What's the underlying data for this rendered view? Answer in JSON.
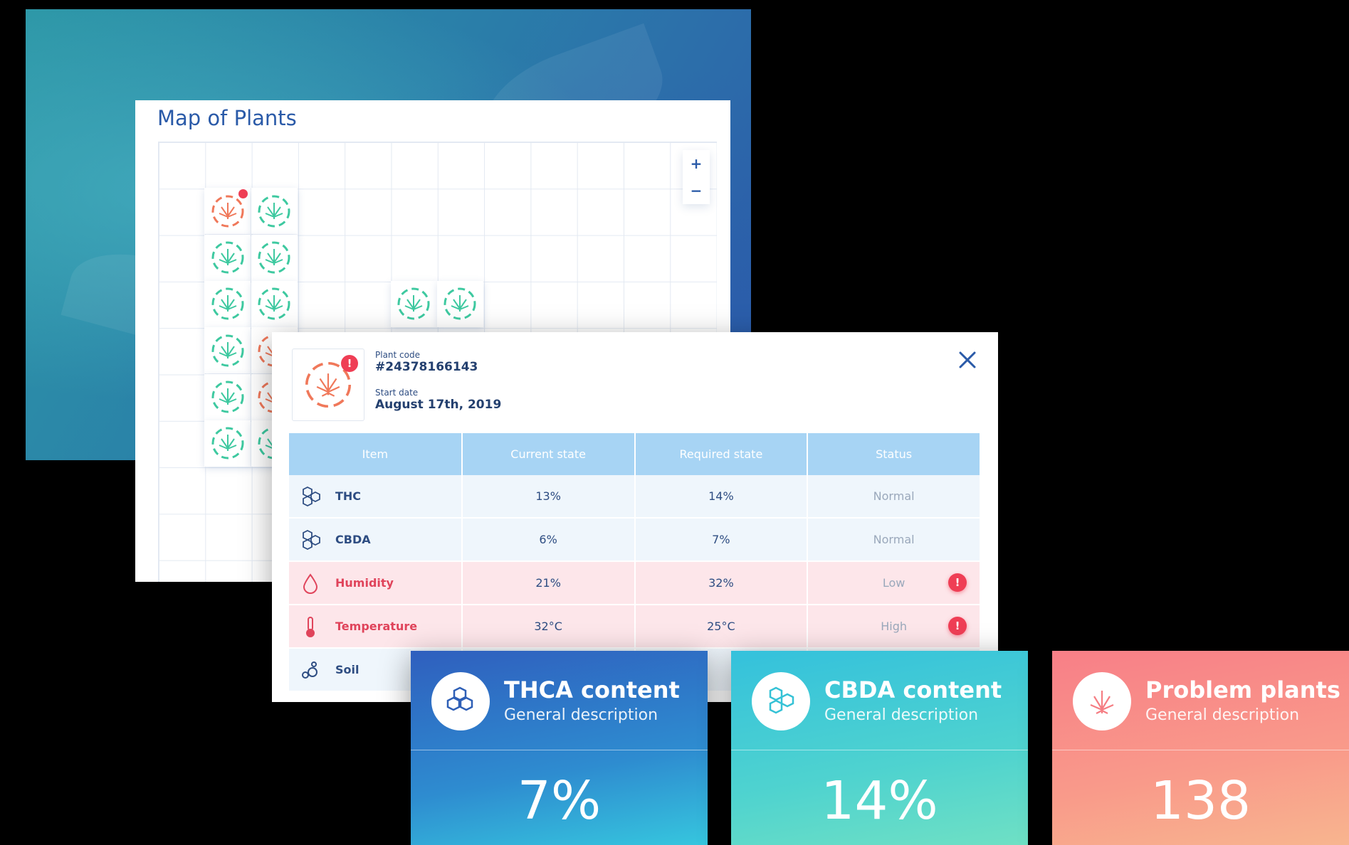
{
  "map": {
    "title": "Map of Plants",
    "zoom_in": "+",
    "zoom_out": "−"
  },
  "detail": {
    "plant_code_label": "Plant code",
    "plant_code": "#24378166143",
    "start_date_label": "Start date",
    "start_date": "August 17th, 2019",
    "alert_mark": "!",
    "headers": [
      "Item",
      "Current state",
      "Required state",
      "Status"
    ],
    "rows": [
      {
        "item": "THC",
        "icon": "molecule-icon",
        "current": "13%",
        "required": "14%",
        "status": "Normal",
        "alert": false
      },
      {
        "item": "CBDA",
        "icon": "molecule-icon",
        "current": "6%",
        "required": "7%",
        "status": "Normal",
        "alert": false
      },
      {
        "item": "Humidity",
        "icon": "droplet-icon",
        "current": "21%",
        "required": "32%",
        "status": "Low",
        "alert": true
      },
      {
        "item": "Temperature",
        "icon": "thermometer-icon",
        "current": "32°C",
        "required": "25°C",
        "status": "High",
        "alert": true
      },
      {
        "item": "Soil",
        "icon": "soil-icon",
        "current": "",
        "required": "",
        "status": "",
        "alert": false
      }
    ]
  },
  "cards": {
    "thca": {
      "title": "THCA content",
      "subtitle": "General description",
      "value": "7%",
      "icon": "molecule-icon"
    },
    "cbda": {
      "title": "CBDA content",
      "subtitle": "General description",
      "value": "14%",
      "icon": "molecule-icon"
    },
    "problem": {
      "title": "Problem plants",
      "subtitle": "General description",
      "value": "138",
      "icon": "cannabis-leaf-icon"
    }
  },
  "colors": {
    "accent_blue": "#2a5aa8",
    "alert_red": "#ef3e55",
    "plant_green": "#3ec9a0",
    "plant_problem": "#f0785a"
  }
}
